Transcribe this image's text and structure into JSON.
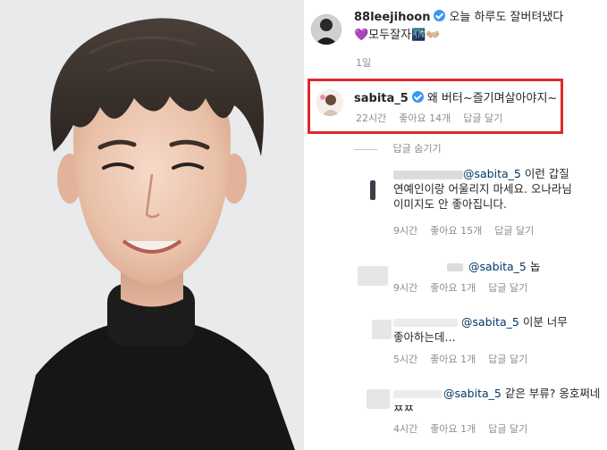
{
  "post": {
    "username": "88leejihoon",
    "caption_line1": "오늘 하루도 잘버텨냈다",
    "caption_line2": "💜모두잘자🌃👐🏼",
    "time": "1일"
  },
  "highlighted_comment": {
    "username": "sabita_5",
    "text": "왜 버터~즐기며살아야지~",
    "time": "22시간",
    "likes": "좋아요 14개",
    "reply": "답글 달기"
  },
  "hide_replies_label": "답글 숨기기",
  "replies": [
    {
      "mention": "@sabita_5",
      "text_line1": " 이런 갑질",
      "text_line2": "연예인이랑 어울리지 마세요. 오나라님",
      "text_line3": "이미지도 안 좋아집니다.",
      "time": "9시간",
      "likes": "좋아요 15개",
      "reply": "답글 달기"
    },
    {
      "mention": "@sabita_5",
      "text_line1": " 놉",
      "time": "9시간",
      "likes": "좋아요 1개",
      "reply": "답글 달기"
    },
    {
      "mention": "@sabita_5",
      "text_line1": " 이분 너무",
      "text_line2": "좋아하는데...",
      "time": "5시간",
      "likes": "좋아요 1개",
      "reply": "답글 달기"
    },
    {
      "mention": "@sabita_5",
      "text_line1": " 같은 부류? 옹호쩌네",
      "text_line2": "ㅉㅉ",
      "time": "4시간",
      "likes": "좋아요 1개",
      "reply": "답글 달기"
    }
  ]
}
